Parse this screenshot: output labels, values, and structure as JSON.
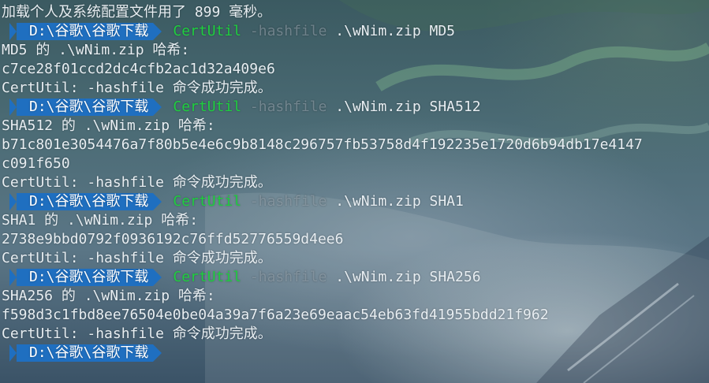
{
  "terminal": {
    "banner": "加载个人及系统配置文件用了 899 毫秒。",
    "prompt_path": "D:\\谷歌\\谷歌下载",
    "blocks": [
      {
        "cmd": "CertUtil",
        "flag": "-hashfile",
        "args": ".\\wNim.zip MD5",
        "header": "MD5 的 .\\wNim.zip 哈希:",
        "hash_lines": [
          "c7ce28f01ccd2dc4cfb2ac1d32a409e6"
        ],
        "done": "CertUtil: -hashfile 命令成功完成。"
      },
      {
        "cmd": "CertUtil",
        "flag": "-hashfile",
        "args": ".\\wNim.zip SHA512",
        "header": "SHA512 的 .\\wNim.zip 哈希:",
        "hash_lines": [
          "b71c801e3054476a7f80b5e4e6c9b8148c296757fb53758d4f192235e1720d6b94db17e4147",
          "c091f650"
        ],
        "done": "CertUtil: -hashfile 命令成功完成。"
      },
      {
        "cmd": "CertUtil",
        "flag": "-hashfile",
        "args": ".\\wNim.zip SHA1",
        "header": "SHA1 的 .\\wNim.zip 哈希:",
        "hash_lines": [
          "2738e9bbd0792f0936192c76ffd52776559d4ee6"
        ],
        "done": "CertUtil: -hashfile 命令成功完成。"
      },
      {
        "cmd": "CertUtil",
        "flag": "-hashfile",
        "args": ".\\wNim.zip SHA256",
        "header": "SHA256 的 .\\wNim.zip 哈希:",
        "hash_lines": [
          "f598d3c1fbd8ee76504e0be04a39a7f6a23e69eaac54eb63fd41955bdd21f962"
        ],
        "done": "CertUtil: -hashfile 命令成功完成。"
      }
    ]
  },
  "colors": {
    "prompt_bg": "#1f6fc0",
    "command": "#1fcf3f",
    "text": "#e8eef2",
    "dim": "#a0afb9"
  }
}
